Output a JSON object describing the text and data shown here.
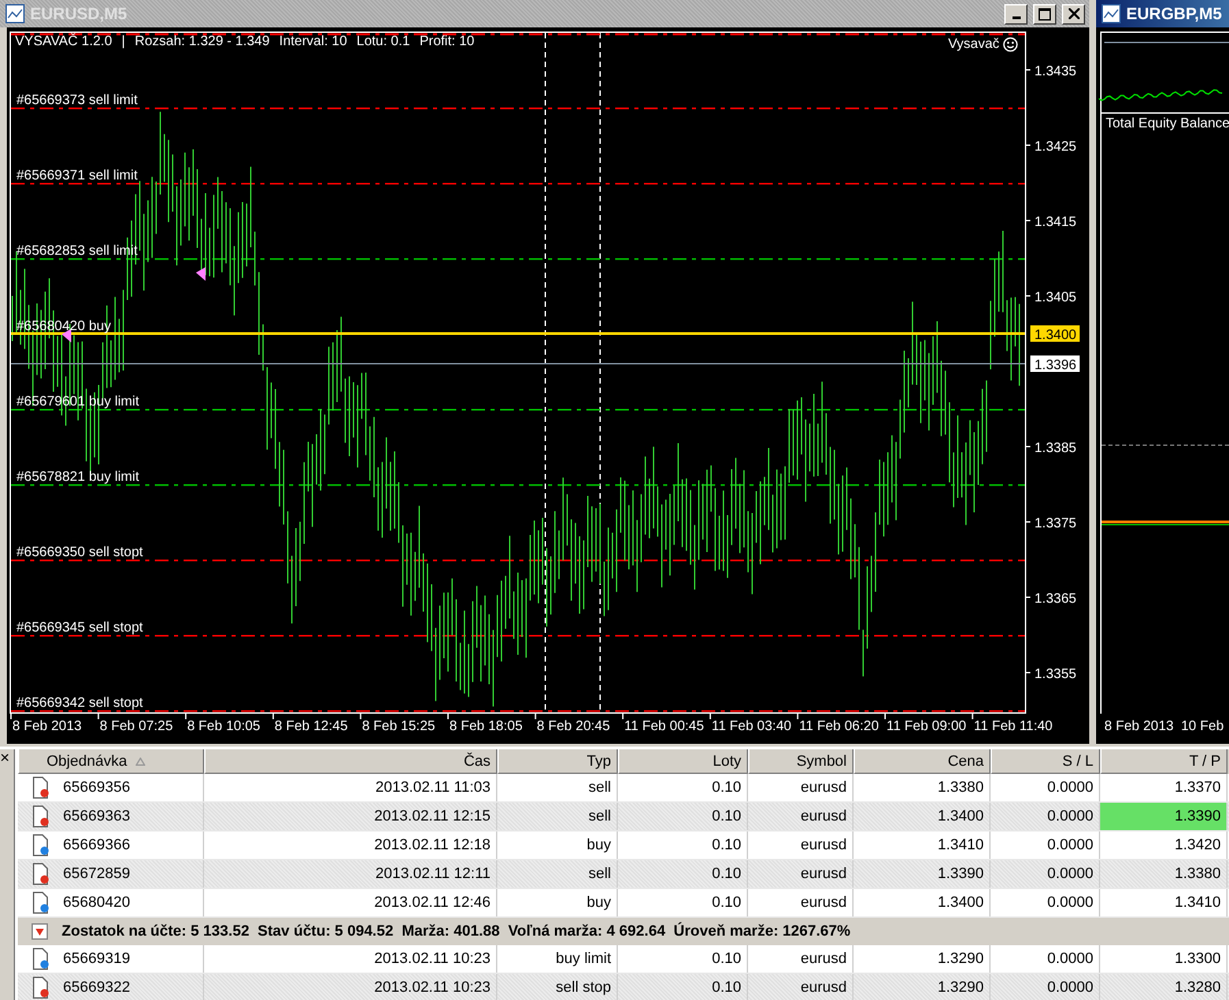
{
  "main_window": {
    "title": "EURUSD,M5",
    "active": false,
    "chart": {
      "header": [
        "VYSAVAČ 1.2.0",
        "|",
        "Rozsah: 1.329 - 1.349",
        "Interval: 10",
        "Lotu: 0.1",
        "Profit: 10"
      ],
      "ea_label": "Vysavač",
      "y_labels": [
        "1.3435",
        "1.3425",
        "1.3415",
        "1.3405",
        "1.3385",
        "1.3375",
        "1.3365",
        "1.3355"
      ],
      "x_labels": [
        "8 Feb 2013",
        "8 Feb 07:25",
        "8 Feb 10:05",
        "8 Feb 12:45",
        "8 Feb 15:25",
        "8 Feb 18:05",
        "8 Feb 20:45",
        "11 Feb 00:45",
        "11 Feb 03:40",
        "11 Feb 06:20",
        "11 Feb 09:00",
        "11 Feb 11:40"
      ],
      "order_lines": [
        {
          "label": "#65669373 sell limit",
          "color": "#ff0000"
        },
        {
          "label": "#65669371 sell limit",
          "color": "#ff0000"
        },
        {
          "label": "#65682853 sell limit",
          "color": "#00c000"
        },
        {
          "label": "#65680420 buy",
          "color": "#ffd700"
        },
        {
          "label": "#65679601 buy limit",
          "color": "#00c000"
        },
        {
          "label": "#65678821 buy limit",
          "color": "#00c000"
        },
        {
          "label": "#65669350 sell stopt",
          "color": "#ff0000"
        },
        {
          "label": "#65669345 sell stopt",
          "color": "#ff0000"
        },
        {
          "label": "#65669342 sell stopt",
          "color": "#ff0000"
        }
      ],
      "price_tags": [
        {
          "kind": "order",
          "text": "1.3400"
        },
        {
          "kind": "bid",
          "text": "1.3396"
        }
      ]
    }
  },
  "side_window": {
    "title": "EURGBP,M5",
    "active": true,
    "indicator_label": "Total Equity Balance",
    "x_labels": [
      "8 Feb 2013",
      "10 Feb"
    ]
  },
  "terminal": {
    "close": "×",
    "columns": [
      "Objednávka",
      "Čas",
      "Typ",
      "Loty",
      "Symbol",
      "Cena",
      "S / L",
      "T / P"
    ],
    "rows": [
      {
        "kind": "order",
        "color": "#e03020",
        "cells": [
          "65669356",
          "2013.02.11 11:03",
          "sell",
          "0.10",
          "eurusd",
          "1.3380",
          "0.0000",
          "1.3370"
        ],
        "tp_hit": false
      },
      {
        "kind": "order",
        "color": "#e03020",
        "cells": [
          "65669363",
          "2013.02.11 12:15",
          "sell",
          "0.10",
          "eurusd",
          "1.3400",
          "0.0000",
          "1.3390"
        ],
        "tp_hit": true
      },
      {
        "kind": "order",
        "color": "#2080e0",
        "cells": [
          "65669366",
          "2013.02.11 12:18",
          "buy",
          "0.10",
          "eurusd",
          "1.3410",
          "0.0000",
          "1.3420"
        ],
        "tp_hit": false
      },
      {
        "kind": "order",
        "color": "#e03020",
        "cells": [
          "65672859",
          "2013.02.11 12:11",
          "sell",
          "0.10",
          "eurusd",
          "1.3390",
          "0.0000",
          "1.3380"
        ],
        "tp_hit": false
      },
      {
        "kind": "order",
        "color": "#2080e0",
        "cells": [
          "65680420",
          "2013.02.11 12:46",
          "buy",
          "0.10",
          "eurusd",
          "1.3400",
          "0.0000",
          "1.3410"
        ],
        "tp_hit": false
      },
      {
        "kind": "summary",
        "text": "Zostatok na účte: 5 133.52  Stav účtu: 5 094.52  Marža: 401.88  Voľná marža: 4 692.64  Úroveň marže: 1267.67%"
      },
      {
        "kind": "order",
        "color": "#2080e0",
        "cells": [
          "65669319",
          "2013.02.11 10:23",
          "buy limit",
          "0.10",
          "eurusd",
          "1.3290",
          "0.0000",
          "1.3300"
        ],
        "tp_hit": false
      },
      {
        "kind": "order",
        "color": "#e03020",
        "cells": [
          "65669322",
          "2013.02.11 10:23",
          "sell stop",
          "0.10",
          "eurusd",
          "1.3290",
          "0.0000",
          "1.3280"
        ],
        "tp_hit": false
      }
    ]
  }
}
